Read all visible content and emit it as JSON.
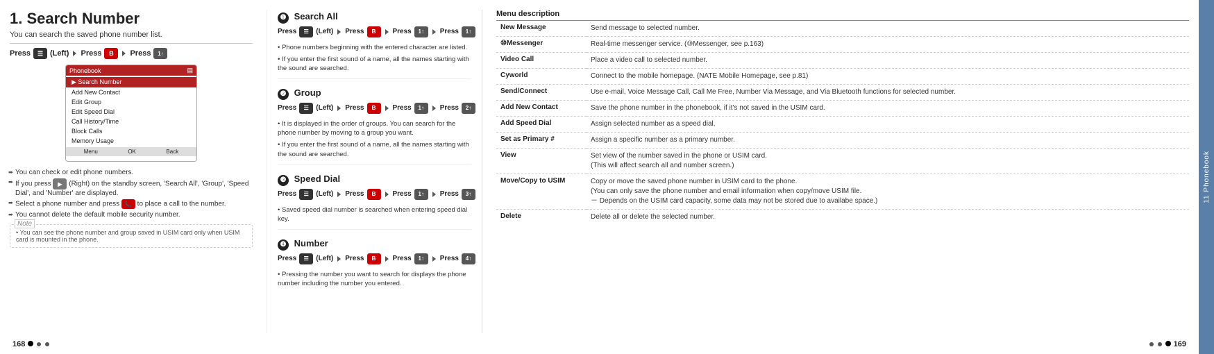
{
  "page": {
    "title": "1. Search Number",
    "subtitle": "You can search the saved phone number list.",
    "page_left": "168",
    "page_right": "169",
    "sidebar_label": "11 Phonebook"
  },
  "left": {
    "press_label": "Press",
    "left_label": "(Left)",
    "press2_label": "Press",
    "press3_label": "Press",
    "phone_screen": {
      "header": "Phonebook",
      "menu_items": [
        {
          "label": "Search Number",
          "selected": true
        },
        {
          "label": "Add New Contact",
          "selected": false
        },
        {
          "label": "Edit Group",
          "selected": false
        },
        {
          "label": "Edit Speed Dial",
          "selected": false
        },
        {
          "label": "Call History/Time",
          "selected": false
        },
        {
          "label": "Block Calls",
          "selected": false
        },
        {
          "label": "Memory Usage",
          "selected": false
        }
      ],
      "footer_items": [
        "Menu",
        "OK",
        "Back"
      ]
    },
    "bullets": [
      "You can check or edit phone numbers.",
      "If you press  (Right) on the standby screen,  'Search All', 'Group', 'Speed Dial', and 'Number' are displayed.",
      "Select a phone number and press  to place a call to the number.",
      "You cannot delete the default mobile security number."
    ],
    "note": "• You can see the phone number and group saved in USIM card only when USIM card is mounted in the phone."
  },
  "middle": {
    "sections": [
      {
        "number": "1",
        "title": "Search All",
        "press_sequence": "Press (Left) ▶ Press ▶ Press ▶ Press",
        "descriptions": [
          "• Phone numbers beginning with the entered character are listed.",
          "• If you enter the first sound of a name, all the names starting with the sound are searched."
        ]
      },
      {
        "number": "2",
        "title": "Group",
        "press_sequence": "Press (Left) ▶ Press ▶ Press ▶ Press",
        "descriptions": [
          "• It is displayed in the order of groups. You can search for the phone number by moving to a group you want.",
          "• If you enter the first sound of a name, all the names starting with the sound are searched."
        ]
      },
      {
        "number": "3",
        "title": "Speed Dial",
        "press_sequence": "Press (Left) ▶ Press ▶ Press ▶ Press",
        "descriptions": [
          "• Saved speed dial number is searched when entering speed dial key."
        ]
      },
      {
        "number": "4",
        "title": "Number",
        "press_sequence": "Press (Left) ▶ Press ▶ Press ▶ Press",
        "descriptions": [
          "• Pressing the number you want to search for displays the phone number including the number you entered."
        ]
      }
    ]
  },
  "right": {
    "menu_description_title": "Menu description",
    "menu_items": [
      {
        "name": "New Message",
        "desc": "Send message to selected number."
      },
      {
        "name": "⑩Messenger",
        "desc": "Real-time messenger service.  (⑩Messenger, see p.163)"
      },
      {
        "name": "Video Call",
        "desc": "Place a video call to selected number."
      },
      {
        "name": "Cyworld",
        "desc": "Connect to the mobile homepage. (NATE Mobile Homepage, see p.81)"
      },
      {
        "name": "Send/Connect",
        "desc": "Use e-mail, Voice Message Call, Call Me Free, Number Via Message, and Via Bluetooth functions for selected number."
      },
      {
        "name": "Add New Contact",
        "desc": "Save the phone number in the phonebook, if it's not saved in the USIM card."
      },
      {
        "name": "Add Speed Dial",
        "desc": "Assign selected number as a speed dial."
      },
      {
        "name": "Set as Primary #",
        "desc": "Assign a specific number as a primary number."
      },
      {
        "name": "View",
        "desc": "Set view of the number saved in the phone or USIM card.\n(This will affect search all and number screen.)"
      },
      {
        "name": "Move/Copy to USIM",
        "desc": "Copy or move the saved phone number in USIM card to the phone.\n(You can only save the phone number and email information when copy/move USIM file.\n－ Depends on the USIM card capacity, some data may not be stored due to availabe space.)"
      },
      {
        "name": "Delete",
        "desc": "Delete all or delete the selected number."
      }
    ]
  }
}
